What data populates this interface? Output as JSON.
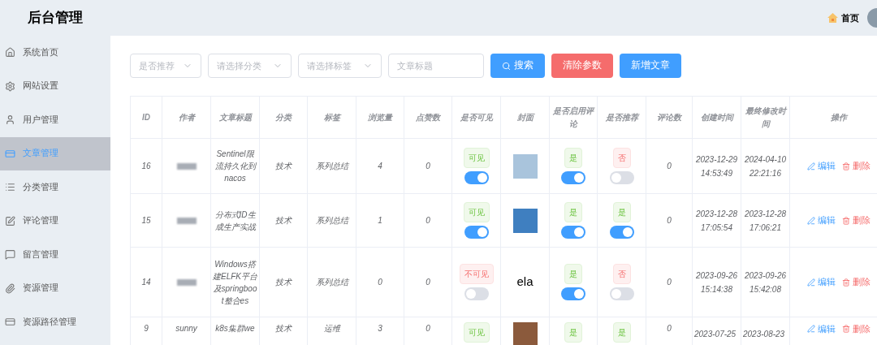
{
  "header": {
    "title": "后台管理",
    "home_link": "首页"
  },
  "sidebar": {
    "items": [
      {
        "label": "系统首页",
        "selected": false
      },
      {
        "label": "网站设置",
        "selected": false
      },
      {
        "label": "用户管理",
        "selected": false
      },
      {
        "label": "文章管理",
        "selected": true
      },
      {
        "label": "分类管理",
        "selected": false
      },
      {
        "label": "评论管理",
        "selected": false
      },
      {
        "label": "留言管理",
        "selected": false
      },
      {
        "label": "资源管理",
        "selected": false
      },
      {
        "label": "资源路径管理",
        "selected": false
      }
    ]
  },
  "filters": {
    "selects": [
      {
        "placeholder": "是否推荐"
      },
      {
        "placeholder": "请选择分类"
      },
      {
        "placeholder": "请选择标签"
      }
    ],
    "search_field": {
      "placeholder": "文章标题"
    },
    "buttons": [
      {
        "label": "搜索",
        "kind": "search"
      },
      {
        "label": "清除参数",
        "kind": "danger"
      },
      {
        "label": "新增文章",
        "kind": "primary"
      }
    ]
  },
  "table": {
    "columns": [
      "ID",
      "作者",
      "文章标题",
      "分类",
      "标签",
      "浏览量",
      "点赞数",
      "是否可见",
      "封面",
      "是否启用评论",
      "是否推荐",
      "评论数",
      "创建时间",
      "最终修改时间",
      "操作"
    ],
    "rows": [
      {
        "id": "16",
        "author": {
          "kind": "blurred"
        },
        "title": "Sentinel限流持久化到nacos",
        "category": "技术",
        "tag": "系列总结",
        "views": "4",
        "likes": "0",
        "visible": {
          "label": "可见",
          "on": true,
          "switch_on": true
        },
        "cover": {
          "kind": "photo"
        },
        "comments_enabled": {
          "label": "是",
          "on": true,
          "switch_on": true
        },
        "recommended": {
          "label": "否",
          "on": false,
          "switch_on": false
        },
        "comments": "0",
        "created": [
          "2023-12-29",
          "14:53:49"
        ],
        "modified": [
          "2024-04-10",
          "22:21:16"
        ],
        "actions": [
          "编辑",
          "删除"
        ]
      },
      {
        "id": "15",
        "author": {
          "kind": "blurred"
        },
        "title": "分布式ID生成生产实战",
        "category": "技术",
        "tag": "系列总结",
        "views": "1",
        "likes": "0",
        "visible": {
          "label": "可见",
          "on": true,
          "switch_on": true
        },
        "cover": {
          "kind": "photo"
        },
        "comments_enabled": {
          "label": "是",
          "on": true,
          "switch_on": true
        },
        "recommended": {
          "label": "是",
          "on": true,
          "switch_on": true
        },
        "comments": "0",
        "created": [
          "2023-12-28",
          "17:05:54"
        ],
        "modified": [
          "2023-12-28",
          "17:06:21"
        ],
        "actions": [
          "编辑",
          "删除"
        ]
      },
      {
        "id": "14",
        "author": {
          "kind": "blurred"
        },
        "title": "Windows搭建ELFK平台及springboot整合es",
        "category": "技术",
        "tag": "系列总结",
        "views": "0",
        "likes": "0",
        "visible": {
          "label": "不可见",
          "on": false,
          "switch_on": false
        },
        "cover": {
          "kind": "text",
          "text": "ela"
        },
        "comments_enabled": {
          "label": "是",
          "on": true,
          "switch_on": true
        },
        "recommended": {
          "label": "否",
          "on": false,
          "switch_on": false
        },
        "comments": "0",
        "created": [
          "2023-09-26",
          "15:14:38"
        ],
        "modified": [
          "2023-09-26",
          "15:42:08"
        ],
        "actions": [
          "编辑",
          "删除"
        ]
      },
      {
        "id": "9",
        "author": {
          "kind": "text",
          "text": "sunny"
        },
        "title": "k8s集群we",
        "category": "技术",
        "tag": "运维",
        "views": "3",
        "likes": "0",
        "visible": {
          "label": "可见",
          "on": true
        },
        "cover": {
          "kind": "photo"
        },
        "comments_enabled": {
          "label": "是",
          "on": true
        },
        "recommended": {
          "label": "是",
          "on": true
        },
        "comments": "0",
        "created": [
          "2023-07-25"
        ],
        "modified": [
          "2023-08-23"
        ],
        "actions": [
          "编辑",
          "删除"
        ]
      }
    ]
  }
}
